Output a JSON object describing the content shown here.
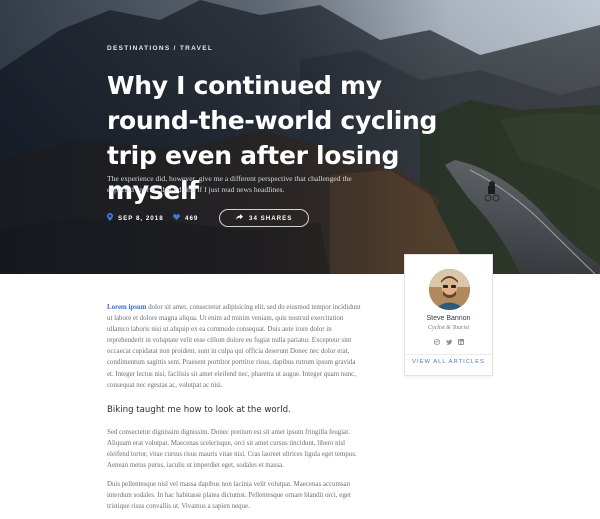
{
  "hero": {
    "breadcrumb": "DESTINATIONS / TRAVEL",
    "title": "Why I continued my round-the-world cycling trip even after losing myself",
    "subtitle": "The experience did, however, give me a different perspective that challenged the expected “norm” that I'd find if I just read news headlines.",
    "meta": {
      "date": "SEP 8, 2018",
      "likes": "469",
      "shares": "34 SHARES"
    },
    "icons": {
      "date": "map-pin-icon",
      "likes": "heart-icon",
      "shares": "share-icon"
    },
    "accent": "#3a7bd5"
  },
  "article": {
    "lead_bold": "Lorem ipsum",
    "lead_rest": " dolor sit amet, consectetur adipisicing elit, sed do eiusmod tempor incididunt ut labore et dolore magna aliqua. Ut enim ad minim veniam, quis nostrud exercitation ullamco laboris nisi ut aliquip ex ea commodo consequat. Duis aute irure dolor in reprehenderit in voluptate velit esse cillum dolore eu fugiat nulla pariatur. Excepteur sint occaecat cupidatat non proident, sunt in culpa qui officia deserunt Donec nec dolor erat, condimentum sagittis sem. Praesent porttitor porttitor risus, dapibus rutrum ipsum gravida et. Integer lectus nisi, facilisis sit amet eleifend nec, pharetra ut augue. Integer quam nunc, consequat nec egestas ac, volutpat ac nisi.",
    "heading": "Biking taught me how to look at the world.",
    "paragraph2": "Sed consectetur dignissim dignissim. Donec pretium est sit amet ipsum fringilla feugiat. Aliquam erat volutpat. Maecenas scelerisque, orci sit amet cursus tincidunt, libero nisl eleifend tortor, vitae cursus risus mauris vitae nisi. Cras laoreet ultrices ligula eget tempus. Aenean metus purus, iaculis ut imperdiet eget, sodales et massa.",
    "paragraph3": "Duis pellentesque nisl vel massa dapibus non lacinia velit volutpat. Maecenas accumsan interdum sodales. In hac habitasse platea dictumst. Pellentesque ornare blandit orci, eget tristique risus convallis ut. Vivamus a sapien neque."
  },
  "author": {
    "name": "Steve Bannon",
    "role": "Cyclist & Tourist",
    "social_icons": [
      "dribbble-icon",
      "twitter-icon",
      "linkedin-icon"
    ],
    "view_all": "VIEW ALL ARTICLES"
  }
}
